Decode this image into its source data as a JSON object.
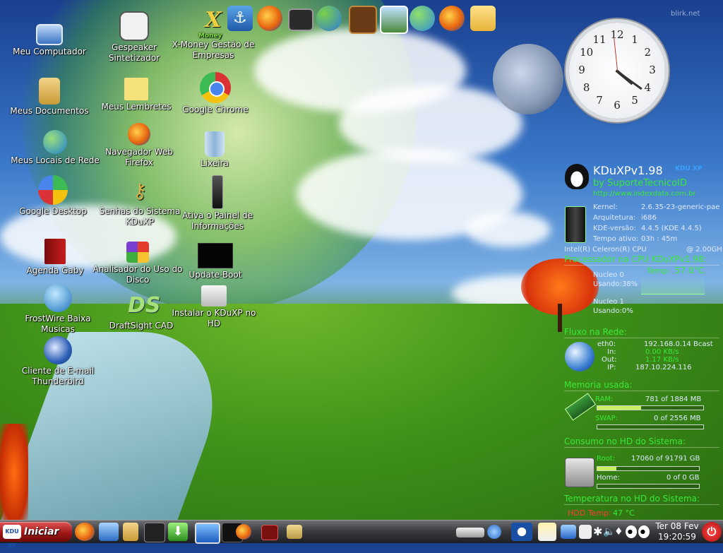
{
  "watermark": "blirk.net",
  "desktop_icons": [
    {
      "label": "Meu Computador"
    },
    {
      "label": "Gespeaker Sintetizador"
    },
    {
      "label": "X-Money Gestão de Empresas"
    },
    {
      "label": "Meus Documentos"
    },
    {
      "label": "Meus Lembretes"
    },
    {
      "label": "Google Chrome"
    },
    {
      "label": "Navegador Web Firefox"
    },
    {
      "label": "Meus Locais de Rede"
    },
    {
      "label": "Lixeira"
    },
    {
      "label": "Google Desktop"
    },
    {
      "label": "Senhas do Sistema KDuXP"
    },
    {
      "label": "Ativa o Painel de Informações"
    },
    {
      "label": "Agenda Gaby"
    },
    {
      "label": "Analisador do Uso do Disco"
    },
    {
      "label": "Update-Boot"
    },
    {
      "label": "FrostWire Baixa Musicas"
    },
    {
      "label": "DraftSight CAD"
    },
    {
      "label": "Instalar o KDuXP no HD"
    },
    {
      "label": "Cliente de E-mail Thunderbird"
    }
  ],
  "xmoney_badge": "Money",
  "clock": {
    "numbers": [
      "12",
      "1",
      "2",
      "3",
      "4",
      "5",
      "6",
      "7",
      "8",
      "9",
      "10",
      "11"
    ],
    "hour": 4,
    "minute": 20,
    "second": 59
  },
  "info": {
    "title": "KDuXPv1.98",
    "byline": "by SuporteTecnicoID",
    "url": "http://www.indexdata.com.br",
    "logo_text": "KDU XP",
    "kernel_label": "Kernel:",
    "kernel": "2.6.35-23-generic-pae",
    "arch_label": "Arquitetura:",
    "arch": "i686",
    "kde_label": "KDE-versão:",
    "kde": "4.4.5 (KDE 4.4.5)",
    "uptime_label": "Tempo ativo:",
    "uptime": "03h : 45m",
    "cpu_model": "Intel(R) Celeron(R) CPU",
    "cpu_freq": "@ 2.00GH",
    "cpu_header": "Processador na CPU KDuXPv1.98:",
    "temp_label": "Temp:",
    "temp": "57.0°C",
    "core0_label": "Nucleo 0",
    "core0_use": "Usando:38%",
    "core0_pct": 38,
    "core1_label": "Nucleo 1",
    "core1_use": "Usando:0%",
    "core1_pct": 0,
    "net_header": "Fluxo na Rede:",
    "eth_label": "eth0:",
    "eth_ip": "192.168.0.14",
    "eth_bcast": "Bcast",
    "in_label": "In:",
    "in_val": "0.00 KB/s",
    "out_label": "Out:",
    "out_val": "1.17 KB/s",
    "ip_label": "IP:",
    "ip_val": "187.10.224.116",
    "mem_header": "Memoria usada:",
    "ram_label": "RAM:",
    "ram_val": "781 of 1884 MB",
    "ram_pct": 41,
    "swap_label": "SWAP:",
    "swap_val": "0 of 2556 MB",
    "swap_pct": 0,
    "hd_header": "Consumo no HD do Sistema:",
    "root_label": "Root:",
    "root_val": "17060 of 91791 GB",
    "root_pct": 19,
    "home_label": "Home:",
    "home_val": "0 of 0 GB",
    "home_pct": 0,
    "hdtemp_header": "Temperatura no HD do Sistema:",
    "hdtemp_label": "HDD Temp:",
    "hdtemp_val": "47 °C"
  },
  "taskbar": {
    "start_label": "Iniciar",
    "start_logo": "KDU XP",
    "date": "Ter 08 Fev",
    "time": "19:20:59",
    "power_symbol": "⏻"
  },
  "colors": {
    "accent_green": "#39e83a",
    "start_red": "#a11818",
    "hdd_temp_red": "#ff3b3b"
  }
}
